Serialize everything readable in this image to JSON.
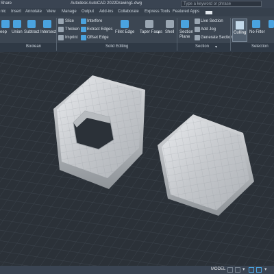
{
  "app": {
    "title": "Autodesk AutoCAD 2022",
    "document": "Drawing1.dwg",
    "share_label": "Share",
    "search_placeholder": "Type a keyword or phrase"
  },
  "tabs": [
    "nic",
    "Insert",
    "Annotate",
    "View",
    "Manage",
    "Output",
    "Add-ins",
    "Collaborate",
    "Express Tools",
    "Featured Apps"
  ],
  "ribbon": {
    "boolean": {
      "sweep": "eep",
      "union": "Union",
      "subtract": "Subtract",
      "intersect": "Intersect"
    },
    "edit_small": {
      "slice": "Slice",
      "thicken": "Thicken",
      "imprint": "Imprint",
      "interfere": "Interfere",
      "extract_edges": "Extract Edges",
      "offset_edge": "Offset Edge"
    },
    "solid": {
      "fillet_edge": "Fillet Edge",
      "taper_faces": "Taper Faces",
      "shell": "Shell"
    },
    "section": {
      "section_plane": "Section Plane",
      "live_section": "Live Section",
      "add_jog": "Add Jog",
      "generate_section": "Generate Section"
    },
    "selection": {
      "culling": "Culling",
      "no_filter": "No Filter"
    },
    "panels": {
      "boolean": "Boolean",
      "solid_editing": "Solid Editing",
      "section": "Section",
      "selection": "Selection"
    }
  },
  "status": {
    "model": "MODEL"
  },
  "colors": {
    "accent": "#4aa3df",
    "viewport_bg": "#2b3138",
    "grid": "#3b434c",
    "solid": "#c8cbcf"
  }
}
